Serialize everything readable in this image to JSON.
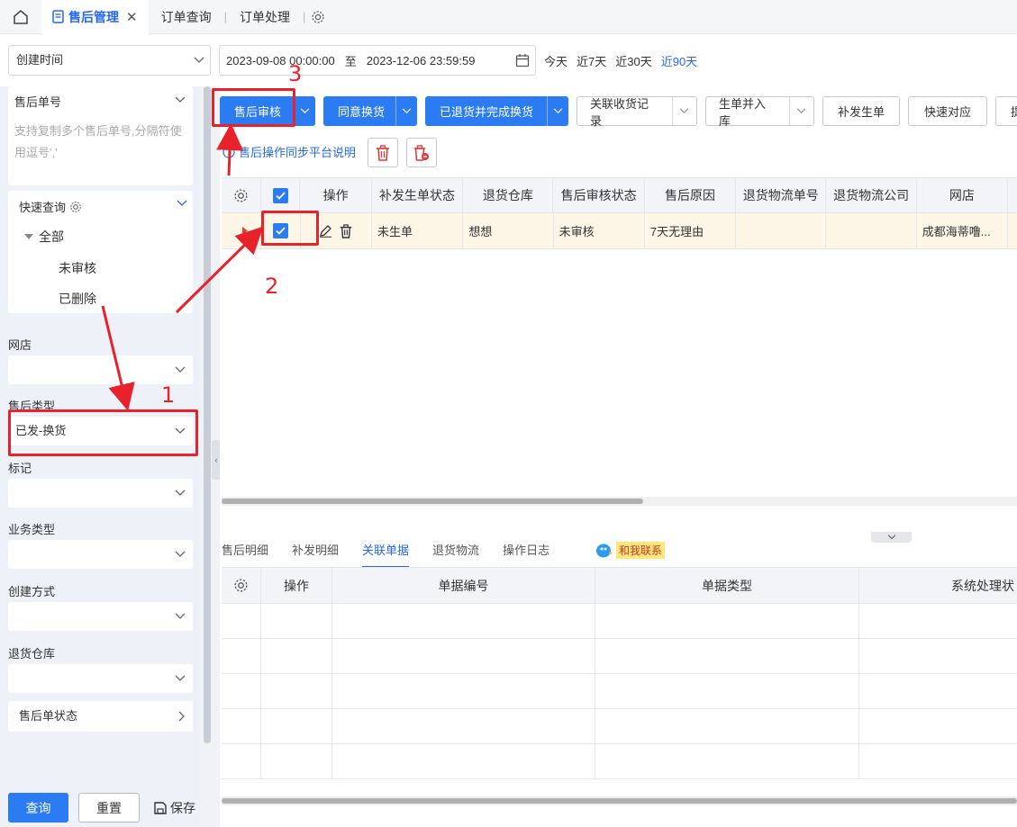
{
  "tabs": {
    "active": "售后管理",
    "items": [
      "订单查询",
      "订单处理"
    ]
  },
  "filters": {
    "date_field": "创建时间",
    "start": "2023-09-08 00:00:00",
    "to": "至",
    "end": "2023-12-06 23:59:59",
    "quick": [
      "今天",
      "近7天",
      "近30天",
      "近90天"
    ],
    "quick_active": "近90天"
  },
  "sidebar": {
    "order_no_label": "售后单号",
    "order_no_placeholder": "支持复制多个售后单号,分隔符使用逗号','",
    "quick_query": "快速查询",
    "tree_all": "全部",
    "tree_items": [
      "未审核",
      "已删除"
    ],
    "shop_label": "网店",
    "type_label": "售后类型",
    "type_value": "已发-换货",
    "mark_label": "标记",
    "biz_label": "业务类型",
    "create_label": "创建方式",
    "warehouse_label": "退货仓库",
    "status_label": "售后单状态",
    "query": "查询",
    "reset": "重置",
    "save": "保存"
  },
  "toolbar": {
    "audit": "售后审核",
    "agree_exchange": "同意换货",
    "returned_done": "已退货并完成换货",
    "link_receipt": "关联收货记录",
    "gen_stock": "生单并入库",
    "reissue": "补发生单",
    "express": "快速对应",
    "more": "提"
  },
  "sync_link": "售后操作同步平台说明",
  "grid": {
    "headers": [
      "操作",
      "补发生单状态",
      "退货仓库",
      "售后审核状态",
      "售后原因",
      "退货物流单号",
      "退货物流公司",
      "网店"
    ],
    "row": {
      "reissue_status": "未生单",
      "warehouse": "想想",
      "audit_status": "未审核",
      "reason": "7天无理由",
      "logistics_no": "",
      "logistics_co": "",
      "shop": "成都海蒂噜..."
    }
  },
  "lower": {
    "tabs": [
      "售后明细",
      "补发明细",
      "关联单据",
      "退货物流",
      "操作日志"
    ],
    "active_tab": "关联单据",
    "contact": "和我联系",
    "headers": [
      "操作",
      "单据编号",
      "单据类型",
      "系统处理状"
    ]
  },
  "annotations": [
    "1",
    "2",
    "3"
  ],
  "colors": {
    "primary": "#2b7bf2",
    "annotation": "#e8222b",
    "selected_row": "#fdf6e6"
  }
}
